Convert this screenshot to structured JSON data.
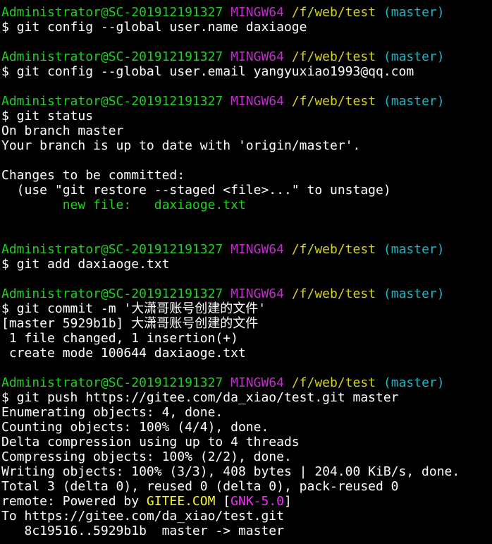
{
  "colors": {
    "background": "#000000",
    "prompt_user": "#1dd11d",
    "prompt_env": "#c22dcc",
    "prompt_path": "#d2d21f",
    "prompt_branch": "#1fb3c2",
    "text": "#ffffff",
    "staged_file": "#1dd11d",
    "gitee_name": "#f7f71f",
    "gitee_tag": "#f22df2"
  },
  "prompt": {
    "user_host": "Administrator@SC-201912191327",
    "env": "MINGW64",
    "path": "/f/web/test",
    "branch": "(master)"
  },
  "lines": [
    {
      "type": "prompt"
    },
    {
      "type": "plain",
      "text": "$ git config --global user.name daxiaoge"
    },
    {
      "type": "blank"
    },
    {
      "type": "prompt"
    },
    {
      "type": "plain",
      "text": "$ git config --global user.email yangyuxiao1993@qq.com"
    },
    {
      "type": "blank"
    },
    {
      "type": "prompt"
    },
    {
      "type": "plain",
      "text": "$ git status"
    },
    {
      "type": "plain",
      "text": "On branch master"
    },
    {
      "type": "plain",
      "text": "Your branch is up to date with 'origin/master'."
    },
    {
      "type": "blank"
    },
    {
      "type": "plain",
      "text": "Changes to be committed:"
    },
    {
      "type": "plain",
      "text": "  (use \"git restore --staged <file>...\" to unstage)"
    },
    {
      "type": "staged",
      "text": "        new file:   daxiaoge.txt"
    },
    {
      "type": "blank"
    },
    {
      "type": "blank"
    },
    {
      "type": "prompt"
    },
    {
      "type": "plain",
      "text": "$ git add daxiaoge.txt"
    },
    {
      "type": "blank"
    },
    {
      "type": "prompt"
    },
    {
      "type": "plain",
      "text": "$ git commit -m '大潇哥账号创建的文件'"
    },
    {
      "type": "plain",
      "text": "[master 5929b1b] 大潇哥账号创建的文件"
    },
    {
      "type": "plain",
      "text": " 1 file changed, 1 insertion(+)"
    },
    {
      "type": "plain",
      "text": " create mode 100644 daxiaoge.txt"
    },
    {
      "type": "blank"
    },
    {
      "type": "prompt"
    },
    {
      "type": "plain",
      "text": "$ git push https://gitee.com/da_xiao/test.git master"
    },
    {
      "type": "plain",
      "text": "Enumerating objects: 4, done."
    },
    {
      "type": "plain",
      "text": "Counting objects: 100% (4/4), done."
    },
    {
      "type": "plain",
      "text": "Delta compression using up to 4 threads"
    },
    {
      "type": "plain",
      "text": "Compressing objects: 100% (2/2), done."
    },
    {
      "type": "plain",
      "text": "Writing objects: 100% (3/3), 408 bytes | 204.00 KiB/s, done."
    },
    {
      "type": "plain",
      "text": "Total 3 (delta 0), reused 0 (delta 0), pack-reused 0"
    },
    {
      "type": "remote",
      "prefix": "remote: Powered by ",
      "name": "GITEE.COM",
      "open": " [",
      "tag": "GNK-5.0",
      "close": "]"
    },
    {
      "type": "plain",
      "text": "To https://gitee.com/da_xiao/test.git"
    },
    {
      "type": "plain",
      "text": "   8c19516..5929b1b  master -> master"
    }
  ]
}
